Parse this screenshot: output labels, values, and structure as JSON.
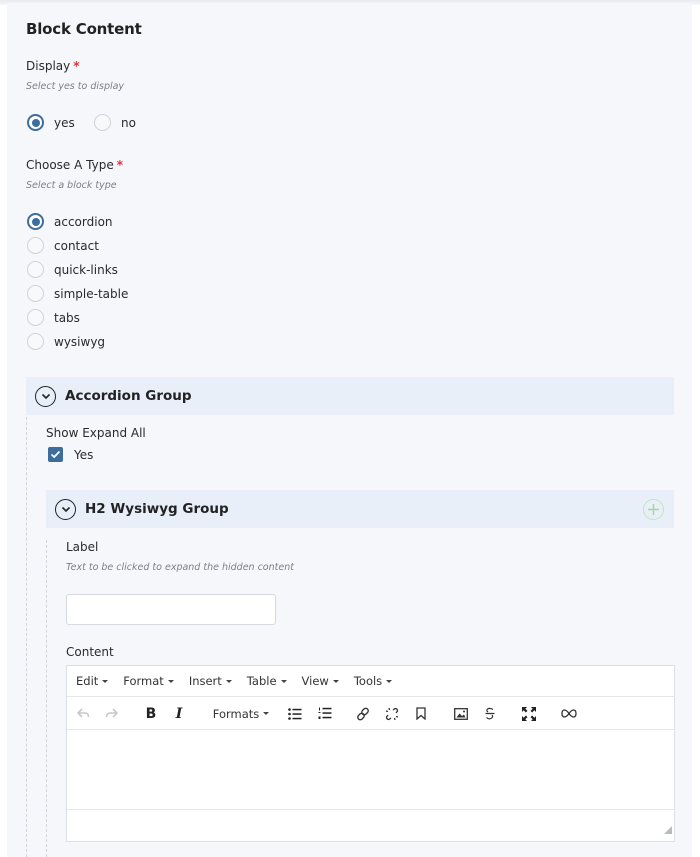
{
  "section": {
    "title": "Block Content"
  },
  "display": {
    "label": "Display",
    "required_mark": "*",
    "hint": "Select yes to display",
    "options": [
      {
        "label": "yes",
        "checked": true
      },
      {
        "label": "no",
        "checked": false
      }
    ]
  },
  "type": {
    "label": "Choose A Type",
    "required_mark": "*",
    "hint": "Select a block type",
    "options": [
      {
        "label": "accordion",
        "checked": true
      },
      {
        "label": "contact",
        "checked": false
      },
      {
        "label": "quick-links",
        "checked": false
      },
      {
        "label": "simple-table",
        "checked": false
      },
      {
        "label": "tabs",
        "checked": false
      },
      {
        "label": "wysiwyg",
        "checked": false
      }
    ]
  },
  "accordion_group": {
    "title": "Accordion Group",
    "show_expand_all": {
      "label": "Show Expand All",
      "option_label": "Yes",
      "checked": true
    }
  },
  "h2_group": {
    "title": "H2 Wysiwyg Group",
    "label_field": {
      "label": "Label",
      "hint": "Text to be clicked to expand the hidden content",
      "value": "",
      "placeholder": ""
    },
    "content_field": {
      "label": "Content"
    }
  },
  "editor": {
    "menus": [
      "Edit",
      "Format",
      "Insert",
      "Table",
      "View",
      "Tools"
    ],
    "formats_label": "Formats",
    "toolbar_icons": [
      "undo-icon",
      "redo-icon",
      "bold-icon",
      "italic-icon",
      "formats-dropdown",
      "bullet-list-icon",
      "numbered-list-icon",
      "link-icon",
      "unlink-icon",
      "bookmark-icon",
      "image-icon",
      "strikethrough-icon",
      "fullscreen-icon",
      "infinity-icon"
    ],
    "content": ""
  },
  "colors": {
    "accent": "#3d6d9c",
    "required": "#e0333a",
    "group_header_bg": "#e8eff8",
    "panel_bg": "#f5f7fb",
    "add_icon": "#bfe5c0"
  }
}
